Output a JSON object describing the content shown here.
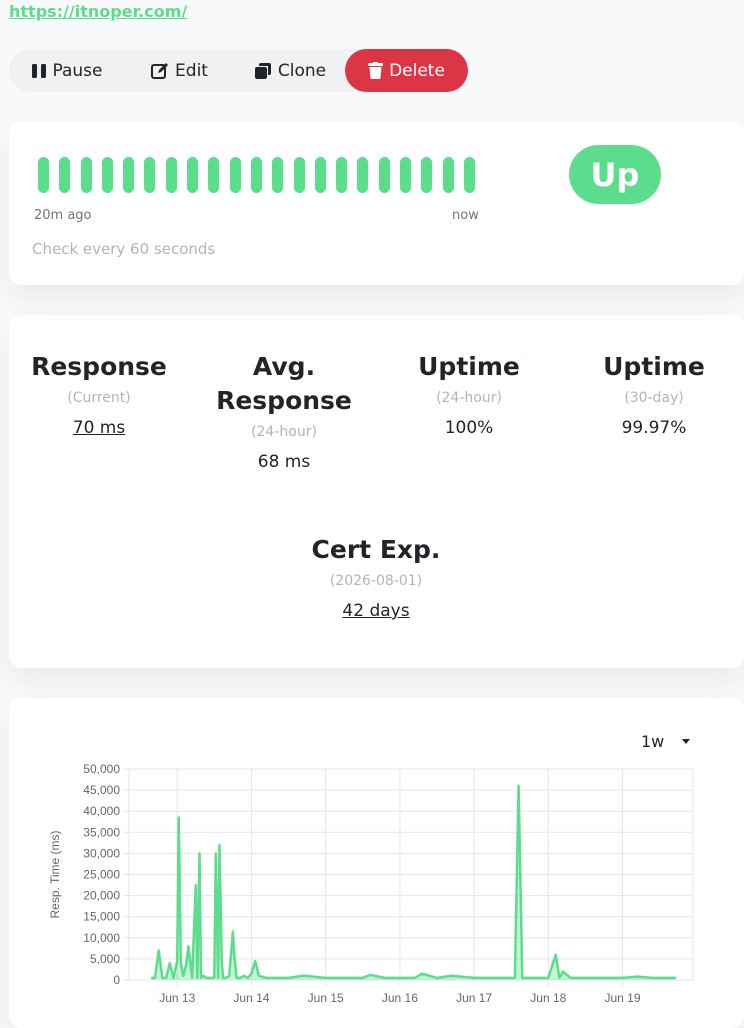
{
  "url": "https://itnoper.com/",
  "buttons": {
    "pause": "Pause",
    "edit": "Edit",
    "clone": "Clone",
    "delete": "Delete"
  },
  "heartbeat": {
    "bar_count": 21,
    "left_label": "20m ago",
    "right_label": "now",
    "interval_text": "Check every 60 seconds",
    "status": "Up",
    "color": "#5cdd8b"
  },
  "stats": [
    {
      "title": "Response",
      "sub": "(Current)",
      "value": "70 ms"
    },
    {
      "title": "Avg. Response",
      "sub": "(24-hour)",
      "value": "68 ms"
    },
    {
      "title": "Uptime",
      "sub": "(24-hour)",
      "value": "100%"
    },
    {
      "title": "Uptime",
      "sub": "(30-day)",
      "value": "99.97%"
    },
    {
      "title": "Cert Exp.",
      "sub": "(2026-08-01)",
      "value": "42 days"
    }
  ],
  "chart": {
    "period": "1w"
  },
  "chart_data": {
    "type": "line",
    "title": "",
    "xlabel": "",
    "ylabel": "Resp. Time (ms)",
    "ylim": [
      0,
      50000
    ],
    "yticks": [
      "0",
      "5,000",
      "10,000",
      "15,000",
      "20,000",
      "25,000",
      "30,000",
      "35,000",
      "40,000",
      "45,000",
      "50,000"
    ],
    "xticks": [
      "Jun 13",
      "Jun 14",
      "Jun 15",
      "Jun 16",
      "Jun 17",
      "Jun 18",
      "Jun 19"
    ],
    "grid": true,
    "color": "#5cdd8b",
    "series": [
      {
        "x": [
          12.65,
          12.7,
          12.75,
          12.8,
          12.85,
          12.9,
          12.95,
          13.0,
          13.02,
          13.05,
          13.08,
          13.12,
          13.15,
          13.2,
          13.25,
          13.27,
          13.3,
          13.32,
          13.35,
          13.4,
          13.5,
          13.52,
          13.55,
          13.57,
          13.6,
          13.62,
          13.65,
          13.7,
          13.75,
          13.77,
          13.8,
          13.85,
          13.9,
          13.95,
          14.0,
          14.05,
          14.1,
          14.2,
          14.3,
          14.5,
          14.7,
          15.0,
          15.3,
          15.5,
          15.6,
          15.8,
          16.0,
          16.2,
          16.3,
          16.5,
          16.7,
          17.0,
          17.2,
          17.4,
          17.55,
          17.6,
          17.65,
          17.8,
          18.0,
          18.1,
          18.15,
          18.2,
          18.3,
          18.5,
          18.8,
          19.0,
          19.2,
          19.4,
          19.6,
          19.72
        ],
        "y": [
          500,
          500,
          7000,
          500,
          500,
          4000,
          500,
          4500,
          38500,
          4000,
          1000,
          3500,
          8000,
          500,
          22500,
          500,
          30000,
          500,
          1000,
          500,
          500,
          30000,
          500,
          32000,
          4000,
          500,
          500,
          1000,
          11500,
          5500,
          500,
          500,
          1000,
          500,
          1500,
          4500,
          1000,
          500,
          500,
          500,
          1000,
          500,
          500,
          500,
          1200,
          500,
          500,
          500,
          1500,
          500,
          1000,
          500,
          500,
          500,
          500,
          46000,
          500,
          500,
          500,
          6000,
          500,
          2000,
          500,
          500,
          500,
          500,
          800,
          500,
          500,
          500
        ]
      }
    ]
  }
}
